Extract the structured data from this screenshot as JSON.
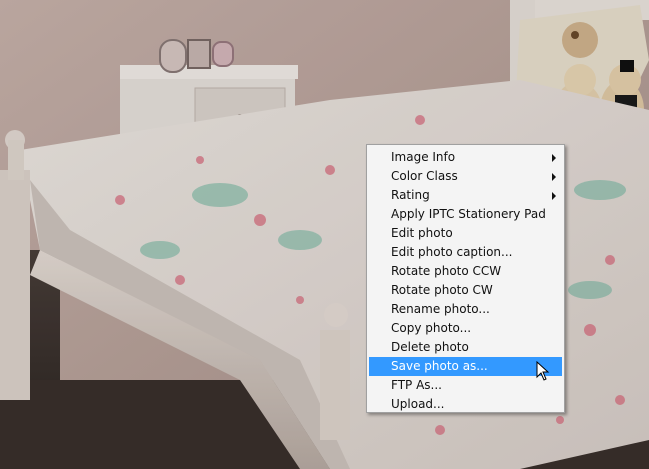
{
  "context_menu": {
    "items": [
      {
        "label": "Image Info",
        "submenu": true
      },
      {
        "label": "Color Class",
        "submenu": true
      },
      {
        "label": "Rating",
        "submenu": true
      },
      {
        "label": "Apply IPTC Stationery Pad",
        "submenu": false
      },
      {
        "label": "Edit photo",
        "submenu": false
      },
      {
        "label": "Edit photo caption...",
        "submenu": false
      },
      {
        "label": "Rotate photo CCW",
        "submenu": false
      },
      {
        "label": "Rotate photo CW",
        "submenu": false
      },
      {
        "label": "Rename photo...",
        "submenu": false
      },
      {
        "label": "Copy photo...",
        "submenu": false
      },
      {
        "label": "Delete photo",
        "submenu": false
      },
      {
        "label": "Save photo as...",
        "submenu": false,
        "selected": true
      },
      {
        "label": "FTP As...",
        "submenu": false
      },
      {
        "label": "Upload...",
        "submenu": false
      }
    ],
    "highlight_color": "#3399ff"
  },
  "photo": {
    "icon": "bedroom-photo"
  },
  "cursor": {
    "icon": "arrow-cursor-icon"
  }
}
